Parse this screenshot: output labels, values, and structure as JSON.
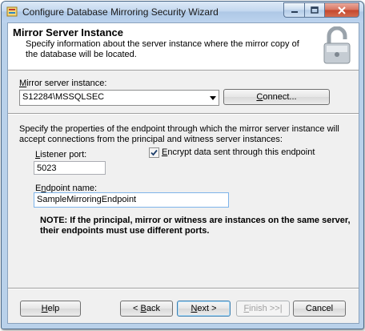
{
  "window": {
    "title": "Configure Database Mirroring Security Wizard"
  },
  "header": {
    "title": "Mirror Server Instance",
    "subtitle": "Specify information about the server instance where the mirror copy of the database will be located."
  },
  "mirror_instance": {
    "label_u": "M",
    "label_rest": "irror server instance:",
    "value": "S12284\\MSSQLSEC",
    "connect_u": "C",
    "connect_rest": "onnect..."
  },
  "endpoint": {
    "description": "Specify the properties of the endpoint through which the mirror server instance will accept connections from the principal and witness server instances:",
    "listener_label_u": "L",
    "listener_label_rest": "istener port:",
    "listener_value": "5023",
    "encrypt_label_u": "E",
    "encrypt_label_rest": "ncrypt data sent through this endpoint",
    "encrypt_checked": true,
    "name_label_pre": "E",
    "name_label_u": "n",
    "name_label_rest": "dpoint name:",
    "name_value": "SampleMirroringEndpoint",
    "note": "NOTE: If the principal, mirror or witness are instances on the same server, their endpoints must use different ports."
  },
  "footer": {
    "help_u": "H",
    "help_rest": "elp",
    "back_pre": "< ",
    "back_u": "B",
    "back_rest": "ack",
    "next_u": "N",
    "next_rest": "ext >",
    "finish_u": "F",
    "finish_rest": "inish >>|",
    "cancel": "Cancel"
  }
}
